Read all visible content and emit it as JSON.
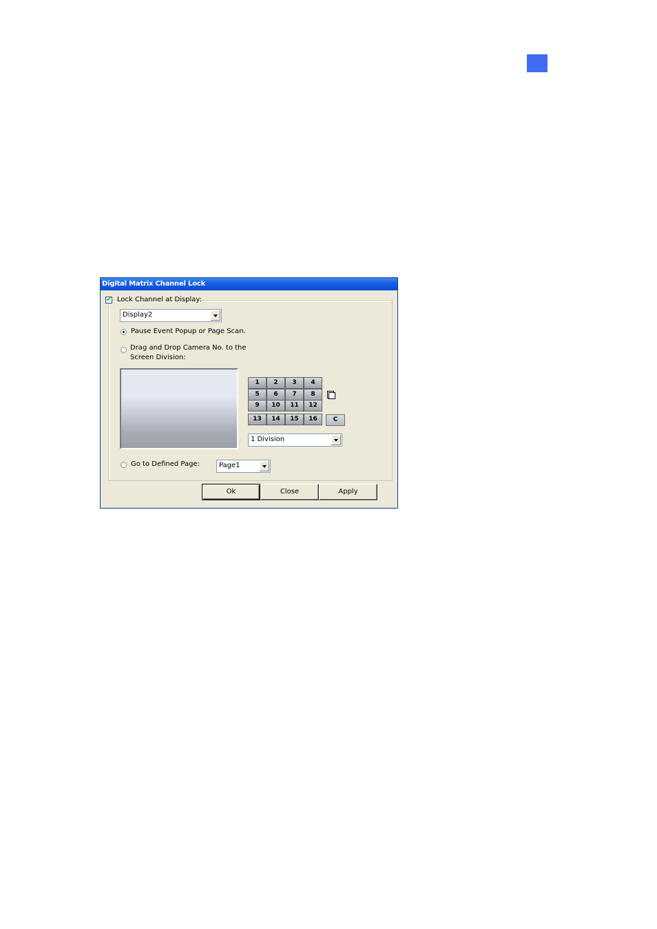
{
  "page": {
    "marker_color": "#3f6cf2"
  },
  "dialog": {
    "title": "Digital Matrix Channel Lock",
    "lock_channel": {
      "label": "Lock Channel at Display:",
      "checked": true
    },
    "display_select": {
      "value": "Display2"
    },
    "options": {
      "pause_label": "Pause Event Popup or Page Scan.",
      "pause_selected": true,
      "drag_label_line1": "Drag and Drop Camera No. to the",
      "drag_label_line2": "Screen Division:",
      "drag_selected": false,
      "goto_label": "Go to Defined Page:",
      "goto_selected": false
    },
    "camera_buttons": [
      "1",
      "2",
      "3",
      "4",
      "5",
      "6",
      "7",
      "8",
      "9",
      "10",
      "11",
      "12",
      "13",
      "14",
      "15",
      "16"
    ],
    "clear_button": "C",
    "copy_icon": "copy-icon",
    "division_select": {
      "value": "1 Division"
    },
    "page_select": {
      "value": "Page1"
    },
    "buttons": {
      "ok": "Ok",
      "close": "Close",
      "apply": "Apply"
    }
  }
}
